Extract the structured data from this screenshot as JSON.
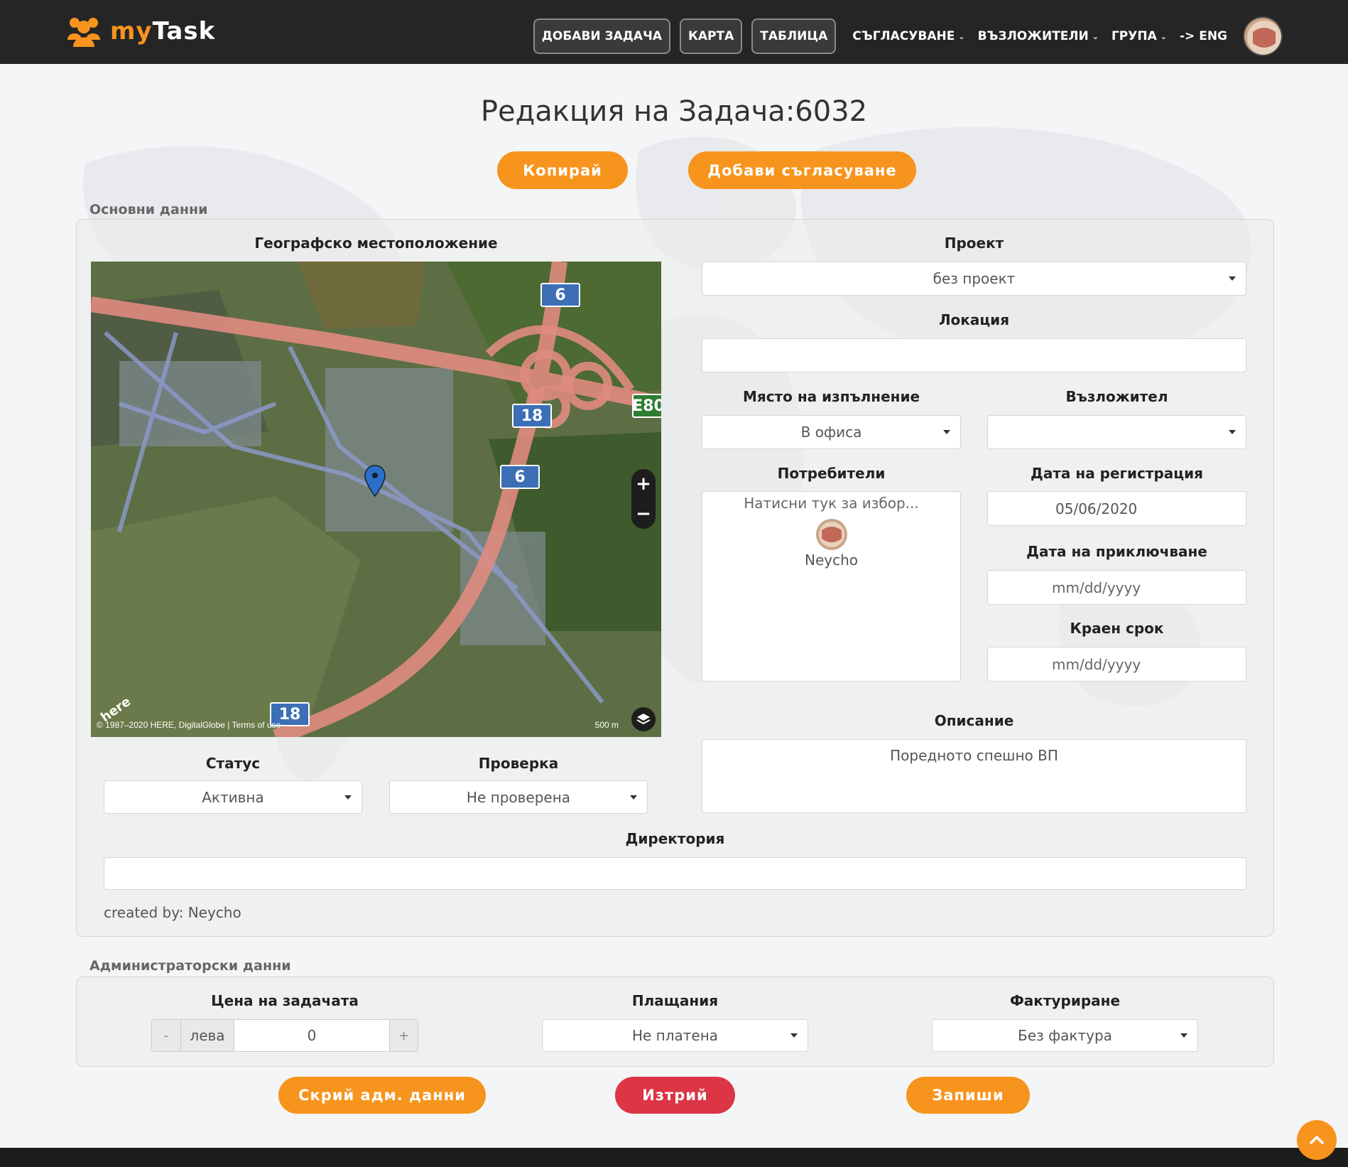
{
  "brand": {
    "my": "my",
    "task": "Task"
  },
  "nav": {
    "buttons": [
      "ДОБАВИ ЗАДАЧА",
      "КАРТА",
      "ТАБЛИЦА"
    ],
    "links": [
      {
        "label": "СЪГЛАСУВАНЕ",
        "dropdown": true
      },
      {
        "label": "ВЪЗЛОЖИТЕЛИ",
        "dropdown": true
      },
      {
        "label": "ГРУПА",
        "dropdown": true
      },
      {
        "label": "-> ENG",
        "dropdown": false
      }
    ]
  },
  "title": "Редакция на Задача:6032",
  "top_buttons": {
    "copy": "Копирай",
    "add_approval": "Добави съгласуване"
  },
  "basic": {
    "section_label": "Основни данни",
    "geo_label": "Географско местоположение",
    "map": {
      "attribution": "© 1987–2020 HERE, DigitalGlobe | Terms of use",
      "scale": "500 m",
      "logo": "here",
      "zoom_in": "+",
      "zoom_out": "−",
      "shields": [
        "6",
        "18",
        "6",
        "18",
        "E80"
      ]
    },
    "project": {
      "label": "Проект",
      "value": "без проект"
    },
    "location": {
      "label": "Локация",
      "value": ""
    },
    "place": {
      "label": "Място на изпълнение",
      "value": "В офиса"
    },
    "assigner": {
      "label": "Възложител",
      "value": ""
    },
    "users": {
      "label": "Потребители",
      "placeholder": "Натисни тук за избор...",
      "user": "Neycho"
    },
    "reg_date": {
      "label": "Дата на регистрация",
      "value": "05/06/2020"
    },
    "end_date": {
      "label": "Дата на приключване",
      "value": "mm/dd/yyyy"
    },
    "deadline": {
      "label": "Краен срок",
      "value": "mm/dd/yyyy"
    },
    "description": {
      "label": "Описание",
      "value": "Поредното спешно ВП"
    },
    "status": {
      "label": "Статус",
      "value": "Активна"
    },
    "check": {
      "label": "Проверка",
      "value": "Не проверена"
    },
    "directory": {
      "label": "Директория",
      "value": ""
    },
    "created_by": "created by: Neycho"
  },
  "admin": {
    "section_label": "Администраторски данни",
    "price": {
      "label": "Цена на задачата",
      "minus": "-",
      "unit": "лева",
      "value": "0",
      "plus": "+"
    },
    "payments": {
      "label": "Плащания",
      "value": "Не платена"
    },
    "invoicing": {
      "label": "Фактуриране",
      "value": "Без фактура"
    }
  },
  "bottom_buttons": {
    "hide_admin": "Скрий адм. данни",
    "delete": "Изтрий",
    "save": "Запиши"
  },
  "colors": {
    "accent": "#f7941d",
    "danger": "#dc3545",
    "navbar": "#252525"
  }
}
